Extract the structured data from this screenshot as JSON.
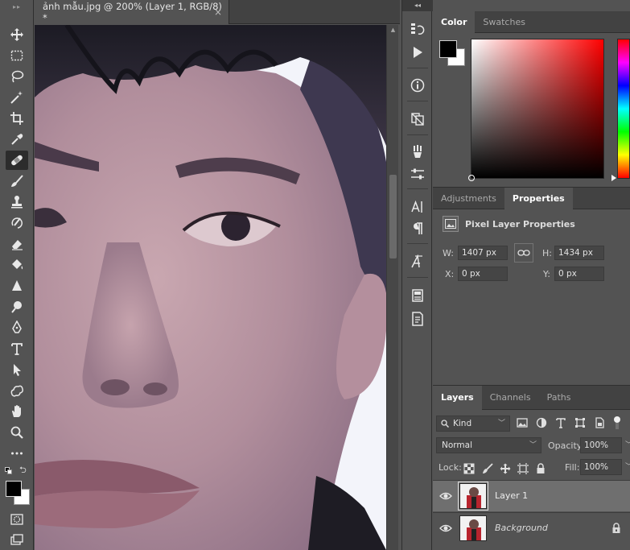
{
  "document": {
    "tab_title": "ảnh mẫu.jpg @ 200% (Layer 1, RGB/8) *",
    "close_glyph": "×",
    "zoom_percent": 200,
    "color_mode": "RGB/8",
    "active_layer": "Layer 1"
  },
  "toolbar": {
    "grip_glyph": "▸▸",
    "tools": [
      {
        "name": "move-tool",
        "icon": "move-icon"
      },
      {
        "name": "marquee-tool",
        "icon": "marquee-icon"
      },
      {
        "name": "lasso-tool",
        "icon": "lasso-icon"
      },
      {
        "name": "magic-wand-tool",
        "icon": "magic-wand-icon"
      },
      {
        "name": "crop-tool",
        "icon": "crop-icon"
      },
      {
        "name": "eyedropper-tool",
        "icon": "eyedropper-icon"
      },
      {
        "name": "healing-brush-tool",
        "icon": "bandage-icon",
        "active": true
      },
      {
        "name": "brush-tool",
        "icon": "brush-icon"
      },
      {
        "name": "clone-stamp-tool",
        "icon": "stamp-icon"
      },
      {
        "name": "history-brush-tool",
        "icon": "history-brush-icon"
      },
      {
        "name": "eraser-tool",
        "icon": "eraser-icon"
      },
      {
        "name": "paint-bucket-tool",
        "icon": "paint-bucket-icon"
      },
      {
        "name": "blur-tool",
        "icon": "blur-icon"
      },
      {
        "name": "dodge-tool",
        "icon": "dodge-icon"
      },
      {
        "name": "pen-tool",
        "icon": "pen-icon"
      },
      {
        "name": "type-tool",
        "icon": "type-icon"
      },
      {
        "name": "path-selection-tool",
        "icon": "arrow-icon"
      },
      {
        "name": "shape-tool",
        "icon": "custom-shape-icon"
      },
      {
        "name": "hand-tool",
        "icon": "hand-icon"
      },
      {
        "name": "zoom-tool",
        "icon": "zoom-icon"
      },
      {
        "name": "more-tools",
        "icon": "more-icon"
      }
    ]
  },
  "dock": {
    "head_glyph": "◂◂"
  },
  "color_panel": {
    "tabs": [
      "Color",
      "Swatches"
    ],
    "active_tab": "Color",
    "foreground": "#000000",
    "background": "#ffffff",
    "hue": "#ff0000"
  },
  "properties_panel": {
    "tabs": [
      "Adjustments",
      "Properties"
    ],
    "active_tab": "Properties",
    "title": "Pixel Layer Properties",
    "w_label": "W:",
    "w_value": "1407 px",
    "h_label": "H:",
    "h_value": "1434 px",
    "x_label": "X:",
    "x_value": "0 px",
    "y_label": "Y:",
    "y_value": "0 px"
  },
  "layers_panel": {
    "tabs": [
      "Layers",
      "Channels",
      "Paths"
    ],
    "active_tab": "Layers",
    "filter_label": "Kind",
    "blend_mode": "Normal",
    "opacity_label": "Opacity:",
    "opacity_value": "100%",
    "lock_label": "Lock:",
    "fill_label": "Fill:",
    "fill_value": "100%",
    "layers": [
      {
        "name": "Layer 1",
        "selected": true,
        "locked": false
      },
      {
        "name": "Background",
        "selected": false,
        "locked": true
      }
    ]
  }
}
